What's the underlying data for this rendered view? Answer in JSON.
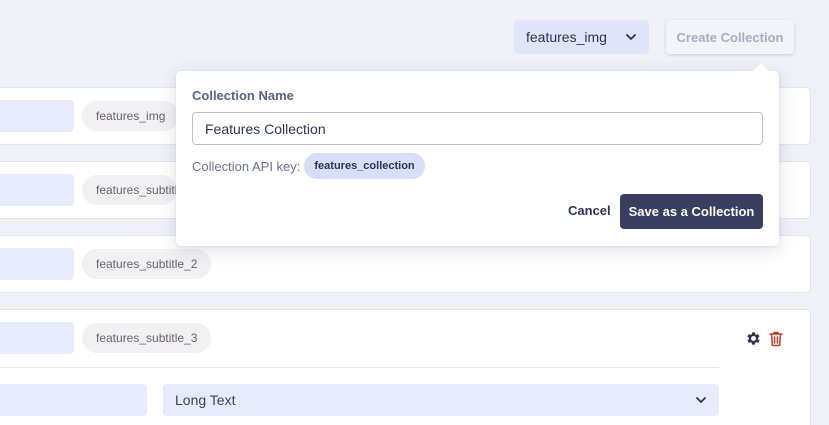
{
  "toolbar": {
    "select_value": "features_img",
    "create_label": "Create Collection"
  },
  "rows": [
    {
      "key": "features_img"
    },
    {
      "key": "features_subtitle"
    },
    {
      "key": "features_subtitle_2"
    },
    {
      "key": "features_subtitle_3",
      "type_value": "Long Text"
    }
  ],
  "popover": {
    "name_label": "Collection Name",
    "name_value": "Features Collection",
    "api_label": "Collection API key:",
    "api_key": "features_collection",
    "cancel_label": "Cancel",
    "save_label": "Save as a Collection"
  },
  "icons": {
    "settings": "gear-icon",
    "delete": "trash-icon",
    "dropdown": "chevron-down-icon"
  },
  "colors": {
    "primary": "#3a3f62",
    "delete": "#c0392b",
    "field_bg": "#e8ebfb"
  }
}
